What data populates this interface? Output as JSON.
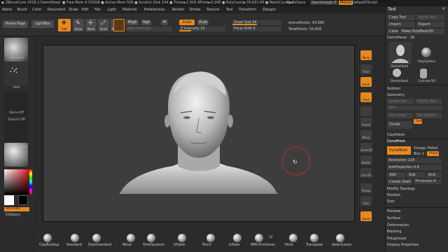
{
  "titlebar": {
    "app": "ZBrushCore 2018.1",
    "doc": "DemoHead",
    "stats": "● Free Mem 4.333GB ● Active Mem 535 ● Scratch Disk 104 ● Timer►1.505 ATime►0.045 ● PolyCount►70.621 KP ● MeshCount►2",
    "quicksave": "QuickSave",
    "seethrough": "See-through 0",
    "menus": "Menus",
    "script": "DefaultZScript"
  },
  "menubar": [
    "Alpha",
    "Brush",
    "Color",
    "Document",
    "Draw",
    "Edit",
    "File",
    "Light",
    "Material",
    "Preferences",
    "Render",
    "Stroke",
    "Texture",
    "Tool",
    "Transform",
    "Zplugin"
  ],
  "toolbar": {
    "home": "Home Page",
    "lightbox": "LightBox",
    "edit": "Edit",
    "draw": "Draw",
    "move": "Move",
    "scale": "Scale",
    "rotate": "Rotate",
    "mrgb": "Mrgb",
    "rgb": "Rgb",
    "m": "M",
    "rgb_intensity": "Rgb Intensity",
    "zadd": "Zadd",
    "zsub": "Zsub",
    "z_intensity": "Z Intensity 25",
    "draw_size": "Draw Size 64",
    "focal_shift": "Focal Shift 0",
    "active_points": "ActivePoints: 43,585",
    "total_points": "TotalPoints: 55,695"
  },
  "progress": {
    "z_intensity": 0.25,
    "draw_size": 0.5
  },
  "leftbar": {
    "standard": "Standard",
    "dots": "Dots",
    "alpha_off": "Alpha Off",
    "texture_off": "Texture Off",
    "matcap": "MatCap Gray",
    "alternate": "Alternate",
    "fillobject": "FillObject"
  },
  "rightshelf": [
    "Persp",
    "Floor",
    "Local",
    "Qxyz",
    "",
    "Frame",
    "Move",
    "Zoom3D",
    "Rotate",
    "Line Fill PolyF",
    "Transp",
    "Solo",
    "Xpose"
  ],
  "bottombar": [
    "ClayBuildup",
    "Standard",
    "DamStandard",
    "Move",
    "TrimDynamic",
    "hPolish",
    "Pinch",
    "Inflate",
    "IMM Primitives",
    "Paint",
    "Transpose",
    "SelectLasso"
  ],
  "imm_count": "14",
  "panel": {
    "title": "Tool",
    "copy_tool": "Copy Tool",
    "paste_tool": "Paste Tool",
    "import": "Import",
    "export": "Export",
    "clone": "Clone",
    "make_polymesh": "Make PolyMesh3D",
    "current_tool": "DemoHead . 18",
    "tools": [
      "DemoHead",
      "PolySphere",
      "DemoHead",
      "Cylinder3D"
    ],
    "subtool": "Subtool",
    "geometry": "Geometry",
    "lower_res": "Lower Res",
    "higher_res": "Higher Res",
    "sdiv": "SDiv",
    "del_lower": "Del Lower",
    "del_higher": "Del Higher",
    "divide": "Divide",
    "smt": "Smt",
    "claypolish": "ClayPolish",
    "dynamesh_header": "DynaMesh",
    "dynamesh": "DynaMesh",
    "groups": "Groups",
    "polish": "Polish",
    "blur": "Blur 2",
    "project": "Project",
    "resolution": "Resolution 128",
    "subprojection": "SubProjection 0.6",
    "add": "Add",
    "sub": "Sub",
    "and": "And",
    "create_shell": "Create Shell",
    "thickness": "Thickness 4",
    "modify_topology": "Modify Topology",
    "position": "Position",
    "size": "Size",
    "preview": "Preview",
    "surface": "Surface",
    "deformation": "Deformation",
    "masking": "Masking",
    "polygroups": "Polygroups",
    "display_properties": "Display Properties"
  },
  "colors": {
    "accent": "#e8891e",
    "panel": "#2f2f2f",
    "canvas": "#3d3d3d",
    "brush_ring": "#c0282a"
  }
}
